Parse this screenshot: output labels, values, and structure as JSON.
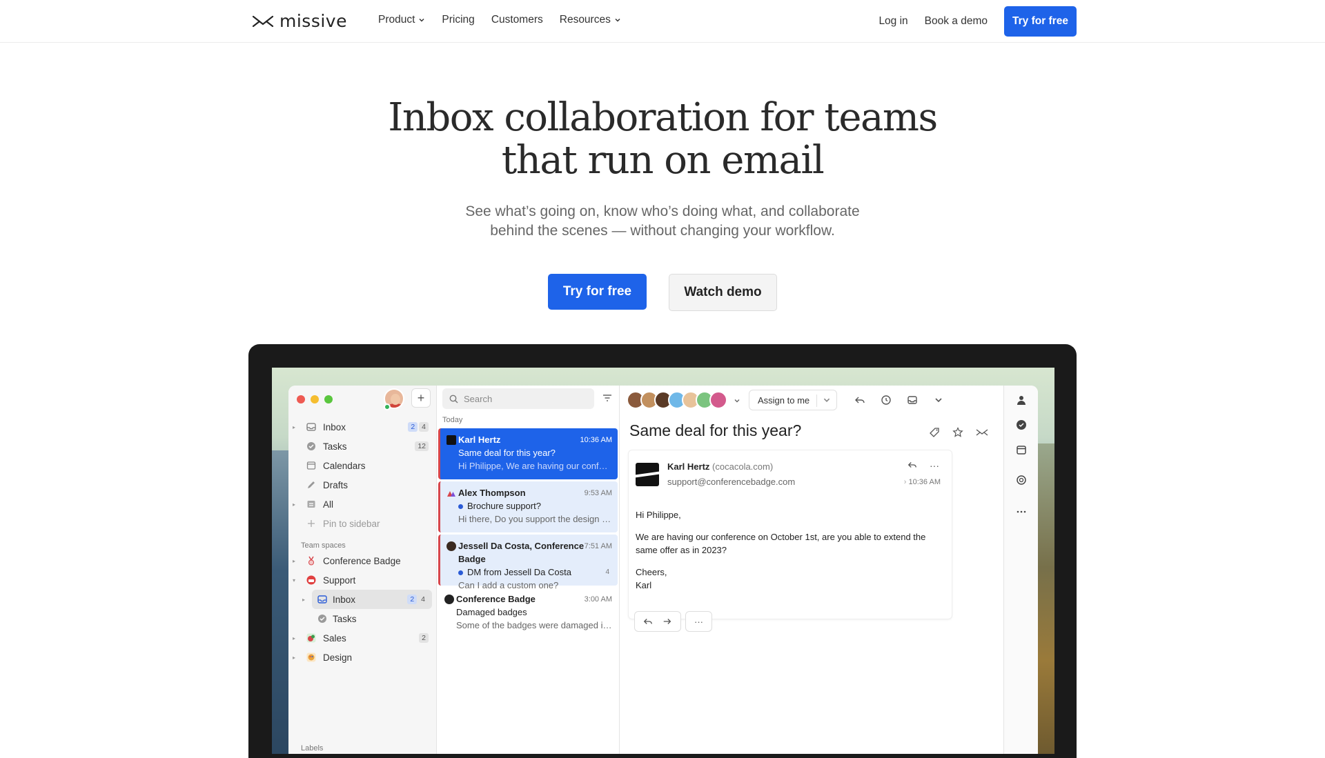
{
  "brand": {
    "name": "missive"
  },
  "nav": {
    "links": [
      {
        "label": "Product",
        "dropdown": true
      },
      {
        "label": "Pricing",
        "dropdown": false
      },
      {
        "label": "Customers",
        "dropdown": false
      },
      {
        "label": "Resources",
        "dropdown": true
      }
    ],
    "login": "Log in",
    "demo": "Book a demo",
    "cta": "Try for free"
  },
  "hero": {
    "title_line1": "Inbox collaboration for teams",
    "title_line2": "that run on email",
    "subtitle_line1": "See what’s going on, know who’s doing what, and collaborate",
    "subtitle_line2": "behind the scenes — without changing your workflow.",
    "primary_cta": "Try for free",
    "secondary_cta": "Watch demo"
  },
  "colors": {
    "accent": "#1e63e9",
    "selected_bar": "#d7464b",
    "online": "#34b35a"
  },
  "app": {
    "sidebar": {
      "add_label": "+",
      "items": [
        {
          "label": "Inbox",
          "icon": "inbox-icon",
          "badges": [
            "2",
            "4"
          ]
        },
        {
          "label": "Tasks",
          "icon": "check-circle-icon",
          "badges": [
            "12"
          ]
        },
        {
          "label": "Calendars",
          "icon": "calendar-icon",
          "badges": []
        },
        {
          "label": "Drafts",
          "icon": "pencil-icon",
          "badges": []
        },
        {
          "label": "All",
          "icon": "archive-icon",
          "badges": []
        },
        {
          "label": "Pin to sidebar",
          "icon": "plus-icon",
          "badges": []
        }
      ],
      "team_spaces_label": "Team spaces",
      "teams": [
        {
          "label": "Conference Badge",
          "icon": "badge-icon",
          "badges": []
        },
        {
          "label": "Support",
          "icon": "support-icon",
          "badges": []
        },
        {
          "label": "Inbox",
          "icon": "inbox-icon",
          "badges": [
            "2",
            "4"
          ]
        },
        {
          "label": "Tasks",
          "icon": "check-circle-icon",
          "badges": []
        },
        {
          "label": "Sales",
          "icon": "sales-icon",
          "badges": [
            "2"
          ]
        },
        {
          "label": "Design",
          "icon": "palette-icon",
          "badges": []
        }
      ],
      "labels_label": "Labels"
    },
    "list": {
      "search_placeholder": "Search",
      "today_label": "Today",
      "conversations": [
        {
          "from": "Karl Hertz",
          "time": "10:36 AM",
          "subject": "Same deal for this year?",
          "preview": "Hi Philippe, We are having our conference ..."
        },
        {
          "from": "Alex Thompson",
          "time": "9:53 AM",
          "subject": "Brochure support?",
          "preview": "Hi there, Do you support the design and pri..."
        },
        {
          "from": "Jessell Da Costa, Conference Badge",
          "time": "7:51 AM",
          "subject": "DM from Jessell Da Costa",
          "count": "4",
          "preview": "Can I add a custom one?"
        },
        {
          "from": "Conference Badge",
          "time": "3:00 AM",
          "subject": "Damaged badges",
          "preview": "Some of the badges were damaged in deliv..."
        }
      ]
    },
    "reader": {
      "assign_label": "Assign to me",
      "subject": "Same deal for this year?",
      "message": {
        "from_name": "Karl Hertz",
        "from_domain": "(cocacola.com)",
        "email": "support@conferencebadge.com",
        "time": "10:36 AM",
        "body": [
          "Hi Philippe,",
          "We are having our conference on October 1st, are you able to extend the same offer as in 2023?",
          "Cheers,"
        ],
        "signature": "Karl"
      },
      "more_label": "···"
    }
  }
}
